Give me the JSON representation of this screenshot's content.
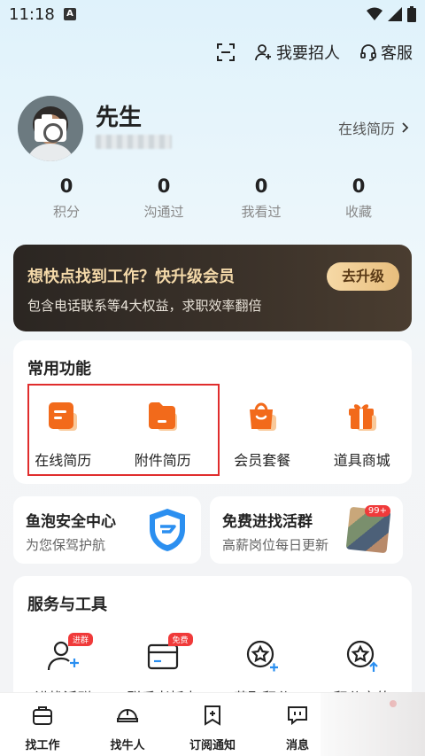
{
  "status": {
    "time": "11:18",
    "a_badge": "A"
  },
  "header": {
    "scan_icon": "scan-icon",
    "recruit_label": "我要招人",
    "service_label": "客服"
  },
  "profile": {
    "name": "先生",
    "resume_link": "在线简历"
  },
  "stats": [
    {
      "value": "0",
      "label": "积分"
    },
    {
      "value": "0",
      "label": "沟通过"
    },
    {
      "value": "0",
      "label": "我看过"
    },
    {
      "value": "0",
      "label": "收藏"
    }
  ],
  "vip": {
    "title": "想快点找到工作？快升级会员",
    "subtitle": "包含电话联系等4大权益，求职效率翻倍",
    "button": "去升级"
  },
  "common": {
    "title": "常用功能",
    "items": [
      {
        "label": "在线简历",
        "icon": "resume-icon"
      },
      {
        "label": "附件简历",
        "icon": "folder-icon"
      },
      {
        "label": "会员套餐",
        "icon": "shopping-bag-icon"
      },
      {
        "label": "道具商城",
        "icon": "gift-icon"
      }
    ]
  },
  "promo": {
    "left": {
      "title": "鱼泡安全中心",
      "subtitle": "为您保驾护航"
    },
    "right": {
      "title": "免费进找活群",
      "subtitle": "高薪岗位每日更新",
      "badge": "99+"
    }
  },
  "services": {
    "title": "服务与工具",
    "items": [
      {
        "label": "进找活群",
        "tag": "进群"
      },
      {
        "label": "联系老板卡",
        "tag": "免费"
      },
      {
        "label": "获取积分",
        "tag": ""
      },
      {
        "label": "积分充值",
        "tag": ""
      }
    ]
  },
  "nav": [
    {
      "label": "找工作"
    },
    {
      "label": "找牛人"
    },
    {
      "label": "订阅通知"
    },
    {
      "label": "消息"
    }
  ],
  "colors": {
    "accent": "#f26a1b",
    "vip_gold": "#f4d9a9",
    "highlight_red": "#e02d2d",
    "shield_blue": "#2b8ff0"
  }
}
